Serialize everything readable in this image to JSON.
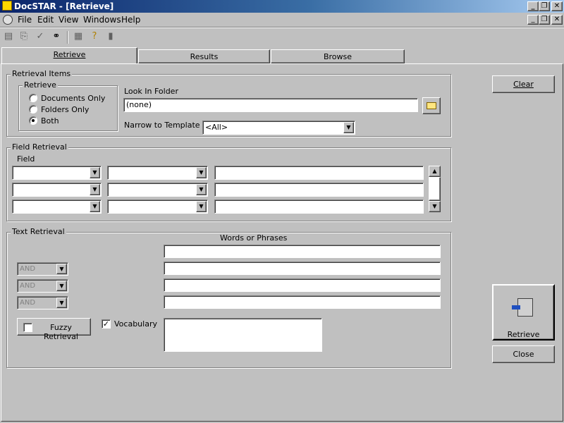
{
  "window": {
    "title": "DocSTAR - [Retrieve]",
    "controls": [
      "_",
      "▫",
      "✕"
    ]
  },
  "menu": [
    "File",
    "Edit",
    "View",
    "Windows",
    "Help"
  ],
  "tabs": [
    "Retrieve",
    "Results",
    "Browse"
  ],
  "retrieval_items": {
    "group_label": "Retrieval Items",
    "retrieve_group_label": "Retrieve",
    "options": [
      "Documents Only",
      "Folders Only",
      "Both"
    ],
    "selected": "Both",
    "look_in_label": "Look In Folder",
    "look_in_value": "(none)",
    "narrow_label": "Narrow to Template",
    "narrow_value": "<All>"
  },
  "field_retrieval": {
    "group_label": "Field Retrieval",
    "field_label": "Field",
    "rows": 3
  },
  "text_retrieval": {
    "group_label": "Text Retrieval",
    "words_label": "Words or Phrases",
    "operators": [
      "AND",
      "AND",
      "AND"
    ],
    "fuzzy_label": "Fuzzy Retrieval",
    "vocabulary_label": "Vocabulary",
    "vocabulary_checked": true,
    "fuzzy_checked": false
  },
  "buttons": {
    "clear": "Clear",
    "retrieve": "Retrieve",
    "close": "Close"
  }
}
